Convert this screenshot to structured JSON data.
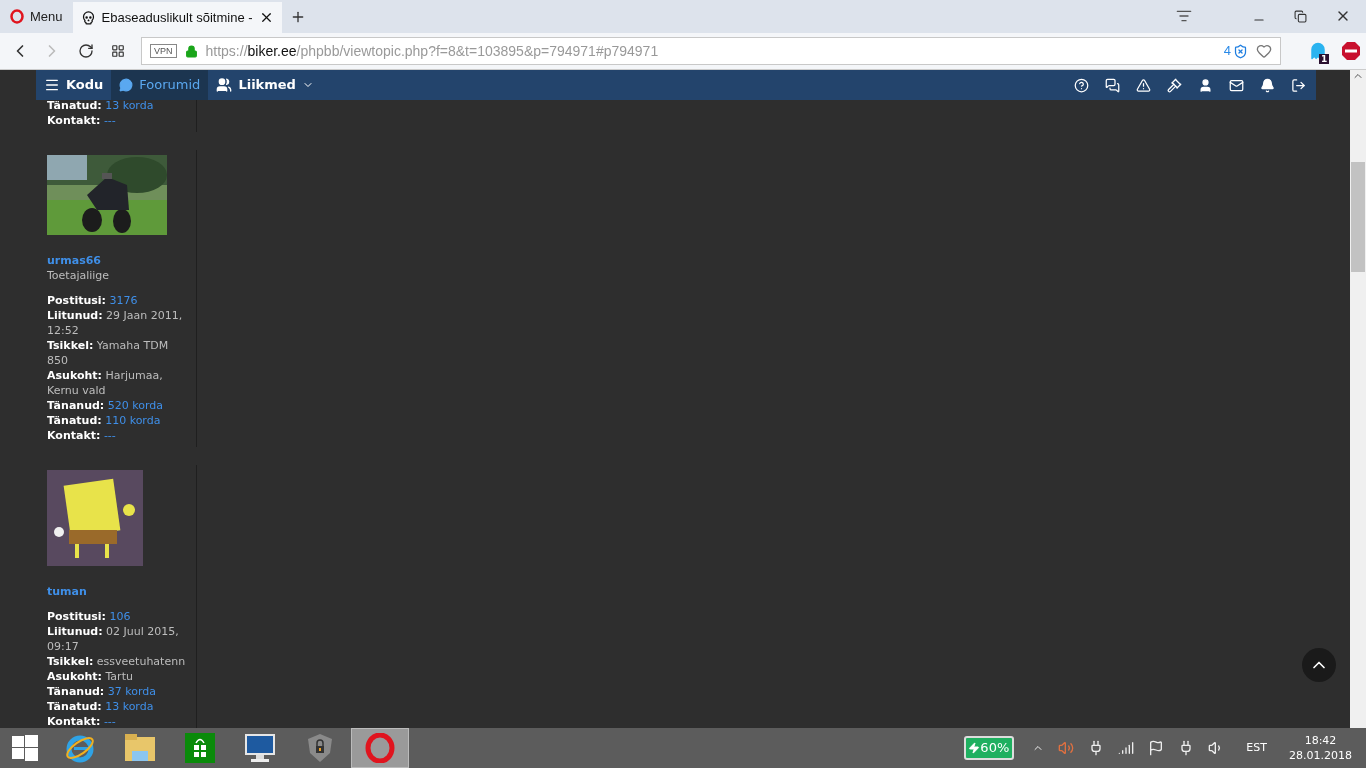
{
  "browser": {
    "menu": "Menu",
    "tabs": [
      {
        "title": "Ebaseaduslikult sõitmine -",
        "selected": true
      }
    ],
    "address": {
      "badge": "VPN",
      "scheme": "https://",
      "host": "biker.ee",
      "path": "/phpbb/viewtopic.php?f=8&t=103895&p=794971#p794971"
    },
    "blocked_count": "4",
    "extension_badge": "1"
  },
  "navbar": {
    "items": [
      {
        "label": "Kodu",
        "kind": "home",
        "selected": false
      },
      {
        "label": "Foorumid",
        "kind": "forums",
        "selected": true
      },
      {
        "label": "Liikmed",
        "kind": "members",
        "selected": false
      }
    ]
  },
  "profiles": [
    {
      "fields": [
        {
          "label": "Tänatud:",
          "value": "13 korda",
          "link": true
        },
        {
          "label": "Kontakt:",
          "value": "---",
          "link": true
        }
      ]
    },
    {
      "avatar": true,
      "username": "urmas66",
      "rank": "Toetajaliige",
      "fields": [
        {
          "label": "Postitusi:",
          "value": "3176",
          "link": true
        },
        {
          "label": "Liitunud:",
          "value": "29 Jaan 2011, 12:52",
          "link": false
        },
        {
          "label": "Tsikkel:",
          "value": "Yamaha TDM 850",
          "link": false
        },
        {
          "label": "Asukoht:",
          "value": "Harjumaa, Kernu vald",
          "link": false
        },
        {
          "label": "Tänanud:",
          "value": "520 korda",
          "link": true
        },
        {
          "label": "Tänatud:",
          "value": "110 korda",
          "link": true
        },
        {
          "label": "Kontakt:",
          "value": "---",
          "link": true
        }
      ]
    },
    {
      "avatar": true,
      "username": "tuman",
      "fields": [
        {
          "label": "Postitusi:",
          "value": "106",
          "link": true
        },
        {
          "label": "Liitunud:",
          "value": "02 Juul 2015, 09:17",
          "link": false
        },
        {
          "label": "Tsikkel:",
          "value": "essveetuhatenn",
          "link": false
        },
        {
          "label": "Asukoht:",
          "value": "Tartu",
          "link": false
        },
        {
          "label": "Tänanud:",
          "value": "37 korda",
          "link": true
        },
        {
          "label": "Tänatud:",
          "value": "13 korda",
          "link": true
        },
        {
          "label": "Kontakt:",
          "value": "---",
          "link": true
        }
      ]
    }
  ],
  "taskbar": {
    "apps": [
      {
        "kind": "ie",
        "selected": false
      },
      {
        "kind": "explorer",
        "selected": false
      },
      {
        "kind": "store",
        "selected": false
      },
      {
        "kind": "monitor",
        "selected": false
      },
      {
        "kind": "shield",
        "selected": false
      },
      {
        "kind": "opera",
        "selected": true
      }
    ],
    "battery": "60%",
    "language": "EST",
    "time": "18:42",
    "date": "28.01.2018"
  }
}
